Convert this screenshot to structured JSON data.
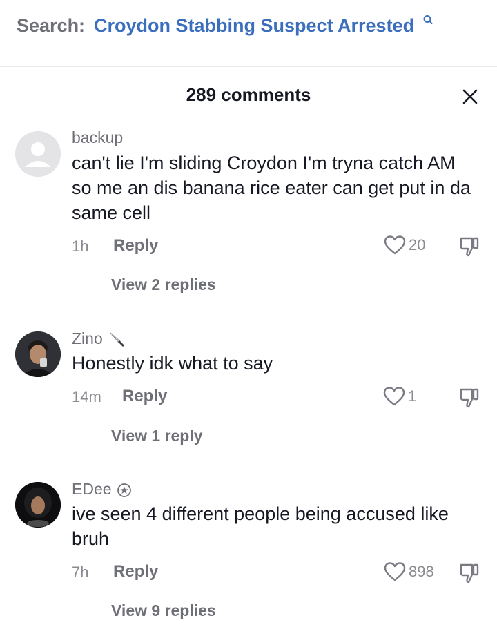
{
  "search": {
    "prefix": "Search:",
    "query": "Croydon Stabbing Suspect Arrested"
  },
  "comments_panel": {
    "count_label": "289 comments"
  },
  "comments": [
    {
      "username": "backup",
      "text": "can't lie I'm sliding Croydon I'm tryna catch AM so me an dis banana rice eater can get put in da same cell",
      "time": "1h",
      "reply_label": "Reply",
      "likes": "20",
      "view_replies": "View 2 replies"
    },
    {
      "username": "Zino",
      "username_badge": "knife-emoji",
      "text": "Honestly idk what to say",
      "time": "14m",
      "reply_label": "Reply",
      "likes": "1",
      "view_replies": "View 1 reply"
    },
    {
      "username": "EDee",
      "username_badge": "star-badge",
      "text": "ive seen 4 different people being accused like bruh",
      "time": "7h",
      "reply_label": "Reply",
      "likes": "898",
      "view_replies": "View 9 replies"
    }
  ],
  "colors": {
    "link_blue": "#3b6fbe",
    "muted_gray": "#6f7077",
    "text_dark": "#161823"
  }
}
